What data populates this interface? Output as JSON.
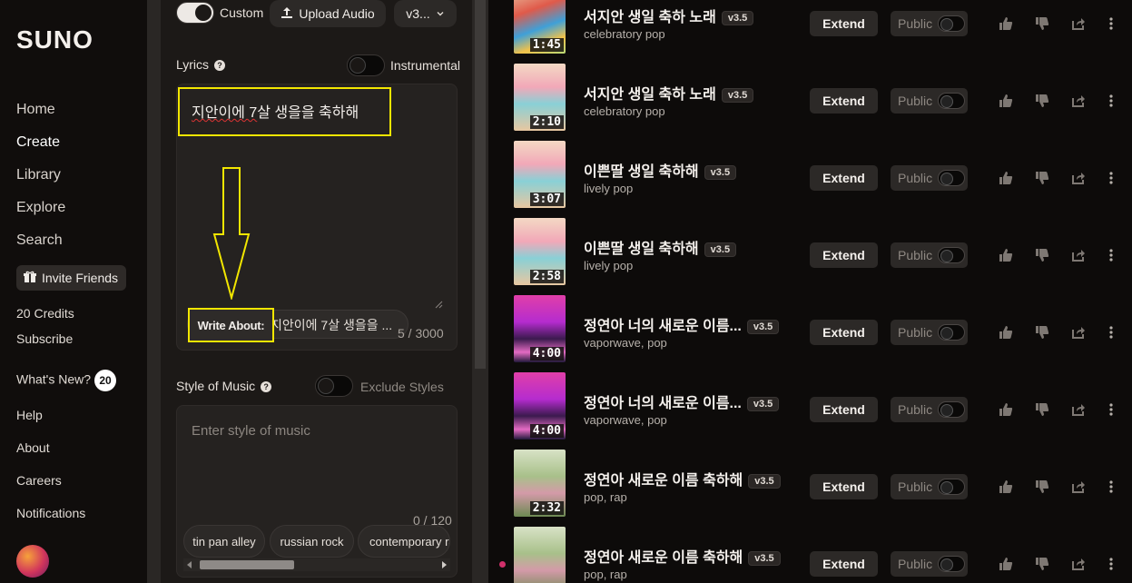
{
  "sidebar": {
    "logo": "SUNO",
    "nav": [
      "Home",
      "Create",
      "Library",
      "Explore",
      "Search"
    ],
    "invite": "Invite Friends",
    "credits": "20 Credits",
    "subscribe": "Subscribe",
    "whats_new": "What's New?",
    "whats_new_count": "20",
    "help": "Help",
    "about": "About",
    "careers": "Careers",
    "notifications": "Notifications"
  },
  "create": {
    "custom_label": "Custom",
    "upload_audio": "Upload Audio",
    "version": "v3...",
    "lyrics_label": "Lyrics",
    "instrumental_label": "Instrumental",
    "lyrics_prefix": "지안이에 7",
    "lyrics_rest": "살 생을을 축하해",
    "lyrics_counter": "5 / 3000",
    "write_about_label": "Write About:",
    "write_about_text": "지안이에 7살 생을을 ...",
    "style_label": "Style of Music",
    "exclude_label": "Exclude Styles",
    "style_placeholder": "Enter style of music",
    "style_counter": "0 / 120",
    "tags": [
      "tin pan alley",
      "russian rock",
      "contemporary r&"
    ]
  },
  "songs": [
    {
      "title": "서지안 생일 축하 노래",
      "version": "v3.5",
      "genre": "celebratory pop",
      "duration": "1:45"
    },
    {
      "title": "서지안 생일 축하 노래",
      "version": "v3.5",
      "genre": "celebratory pop",
      "duration": "2:10"
    },
    {
      "title": "이쁜딸 생일 축하해",
      "version": "v3.5",
      "genre": "lively pop",
      "duration": "3:07"
    },
    {
      "title": "이쁜딸 생일 축하해",
      "version": "v3.5",
      "genre": "lively pop",
      "duration": "2:58"
    },
    {
      "title": "정연아 너의 새로운 이름...",
      "version": "v3.5",
      "genre": "vaporwave, pop",
      "duration": "4:00"
    },
    {
      "title": "정연아 너의 새로운 이름...",
      "version": "v3.5",
      "genre": "vaporwave, pop",
      "duration": "4:00"
    },
    {
      "title": "정연아 새로운 이름 축하해",
      "version": "v3.5",
      "genre": "pop, rap",
      "duration": "2:32"
    },
    {
      "title": "정연아 새로운 이름 축하해",
      "version": "v3.5",
      "genre": "pop, rap",
      "duration": ""
    }
  ],
  "song_actions": {
    "extend": "Extend",
    "public": "Public"
  },
  "thumb_styles": [
    "balloons",
    "cake",
    "cake",
    "cake",
    "vaporwave",
    "vaporwave",
    "landscape",
    "landscape"
  ]
}
